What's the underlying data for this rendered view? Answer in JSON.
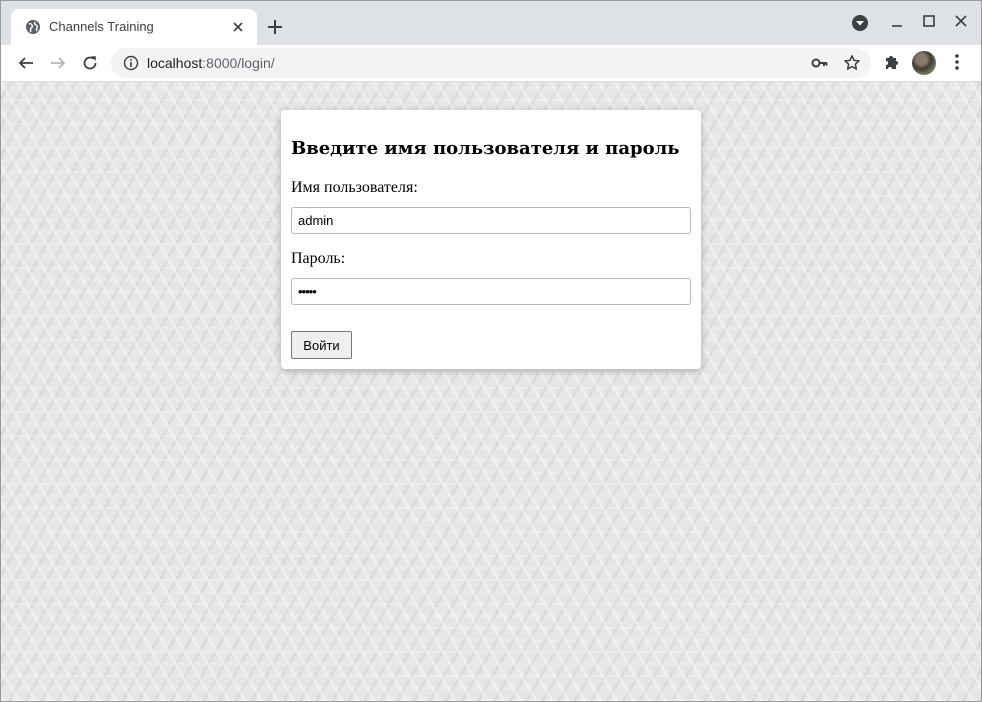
{
  "browser": {
    "tab_title": "Channels Training",
    "url_host": "localhost",
    "url_rest": ":8000/login/"
  },
  "icons": {
    "favicon": "globe-icon",
    "close": "close-icon",
    "new_tab": "plus-icon",
    "profile_dropdown": "chevron-down-icon",
    "minimize": "minimize-icon",
    "maximize": "maximize-icon",
    "window_close": "close-icon",
    "back": "arrow-left-icon",
    "forward": "arrow-right-icon",
    "reload": "reload-icon",
    "site_info": "info-icon",
    "password_key": "key-icon",
    "bookmark": "star-icon",
    "extensions": "puzzle-icon",
    "menu": "more-vert-icon"
  },
  "login": {
    "heading": "Введите имя пользователя и пароль",
    "username_label": "Имя пользователя:",
    "username_value": "admin",
    "password_label": "Пароль:",
    "password_value": "•••••",
    "submit_label": "Войти"
  }
}
